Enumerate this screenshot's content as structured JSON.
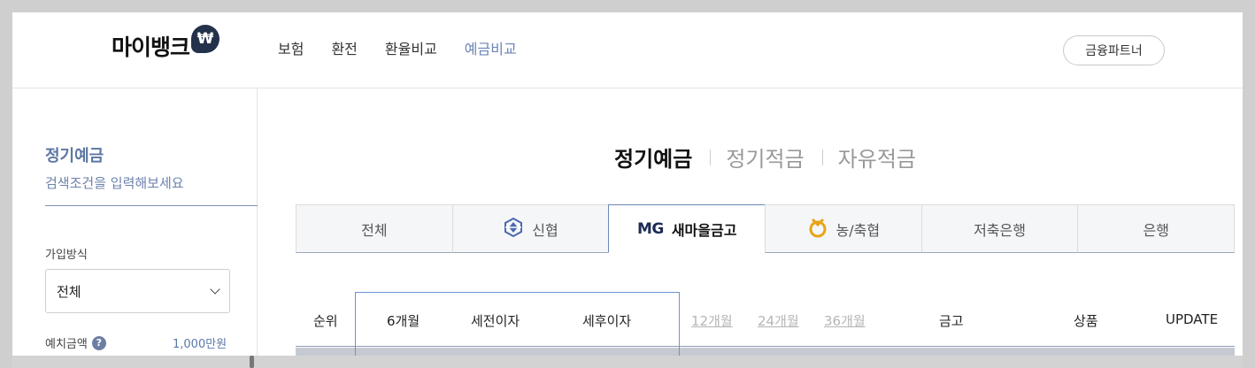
{
  "header": {
    "logo_text": "마이뱅크",
    "logo_badge": "₩",
    "nav": [
      {
        "label": "보험",
        "active": false
      },
      {
        "label": "환전",
        "active": false
      },
      {
        "label": "환율비교",
        "active": false
      },
      {
        "label": "예금비교",
        "active": true
      }
    ],
    "partner_label": "금융파트너"
  },
  "sidebar": {
    "title": "정기예금",
    "subtitle": "검색조건을 입력해보세요",
    "join_label": "가입방식",
    "join_value": "전체",
    "amount_label": "예치금액",
    "amount_help": "?",
    "amount_value": "1,000만원"
  },
  "product_tabs": [
    {
      "label": "정기예금",
      "active": true
    },
    {
      "label": "정기적금",
      "active": false
    },
    {
      "label": "자유적금",
      "active": false
    }
  ],
  "bank_tabs": [
    {
      "label": "전체",
      "icon": "",
      "active": false
    },
    {
      "label": "신협",
      "icon": "shinhyup-logo-icon",
      "active": false
    },
    {
      "label": "새마을금고",
      "icon": "mg-logo-icon",
      "icon_text": "MG",
      "active": true
    },
    {
      "label": "농/축협",
      "icon": "nonghyup-logo-icon",
      "active": false
    },
    {
      "label": "저축은행",
      "icon": "",
      "active": false
    },
    {
      "label": "은행",
      "icon": "",
      "active": false
    }
  ],
  "table": {
    "headers": {
      "rank": "순위",
      "period_6": "6개월",
      "pre_tax": "세전이자",
      "post_tax": "세후이자",
      "period_12": "12개월",
      "period_24": "24개월",
      "period_36": "36개월",
      "bank": "금고",
      "product": "상품",
      "update": "UPDATE"
    }
  },
  "colors": {
    "accent": "#6b86b5",
    "logo_badge": "#23314a",
    "selected_period_border": "#6b94cf"
  }
}
